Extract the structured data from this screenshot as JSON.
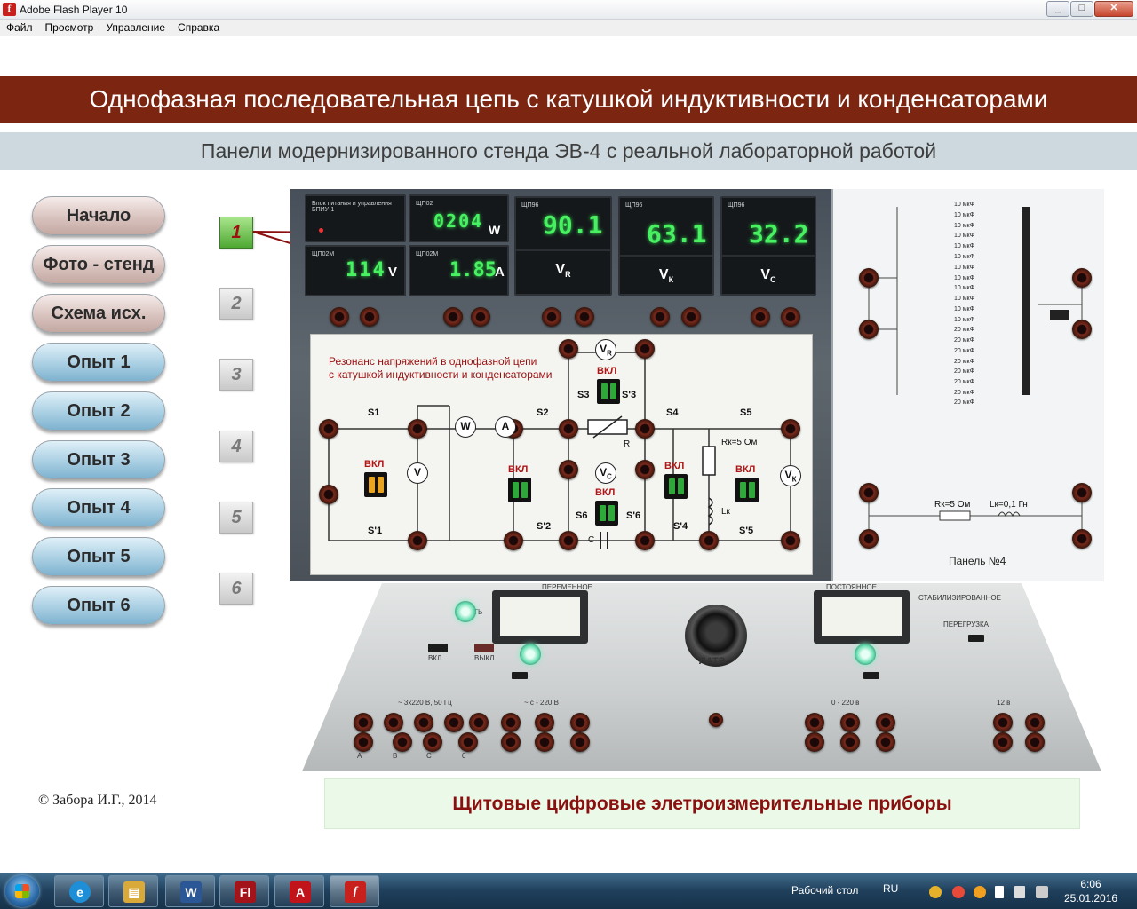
{
  "window": {
    "title": "Adobe Flash Player 10",
    "icon": "flash-icon",
    "controls": [
      "minimize-icon",
      "maximize-icon",
      "close-icon"
    ]
  },
  "menu": [
    "Файл",
    "Просмотр",
    "Управление",
    "Справка"
  ],
  "header": {
    "title": "Однофазная последовательная цепь с катушкой индуктивности и конденсаторами",
    "subtitle": "Панели модернизированного стенда ЭВ-4 с реальной лабораторной работой"
  },
  "nav": [
    {
      "label": "Начало",
      "style": "pink"
    },
    {
      "label": "Фото - стенд",
      "style": "pink"
    },
    {
      "label": "Схема исх.",
      "style": "pink"
    },
    {
      "label": "Опыт 1",
      "style": "blue"
    },
    {
      "label": "Опыт 2",
      "style": "blue"
    },
    {
      "label": "Опыт 3",
      "style": "blue"
    },
    {
      "label": "Опыт 4",
      "style": "blue"
    },
    {
      "label": "Опыт 5",
      "style": "blue"
    },
    {
      "label": "Опыт 6",
      "style": "blue"
    }
  ],
  "steps": [
    "1",
    "2",
    "3",
    "4",
    "5",
    "6"
  ],
  "active_step": "1",
  "stand": {
    "meters": {
      "power_block": {
        "brand": "Блок питания и управления БПИУ-1"
      },
      "wattmeter": {
        "brand": "ЩП02",
        "value": "0204",
        "unit": "W"
      },
      "voltmeter": {
        "brand": "ЩП02М",
        "value": "114",
        "unit": "V"
      },
      "ammeter": {
        "brand": "ЩП02М",
        "value": "1.85",
        "unit": "A"
      },
      "vr": {
        "brand": "ЩП96",
        "value": "90.1",
        "label": "V",
        "sub": "R"
      },
      "vk": {
        "brand": "ЩП96",
        "value": "63.1",
        "label": "V",
        "sub": "К"
      },
      "vc": {
        "brand": "ЩП96",
        "value": "32.2",
        "label": "V",
        "sub": "C"
      }
    },
    "schematic": {
      "caption_line1": "Резонанс  напряжений в однофазной цепи",
      "caption_line2": "с катушкой индуктивности и конденсаторами",
      "switch_labels": [
        "S1",
        "S2",
        "S3",
        "S'3",
        "S4",
        "S5",
        "S6",
        "S'1",
        "S'2",
        "S'4",
        "S'5",
        "S'6"
      ],
      "vkl": "ВКЛ",
      "instruments": {
        "w": "W",
        "a": "A",
        "v": "V",
        "vr": "V",
        "vr_sub": "R",
        "vc": "V",
        "vc_sub": "C",
        "vk": "V",
        "vk_sub": "К"
      },
      "r_label": "R",
      "rk_label": "Rк=5 Ом",
      "lk_label": "Lк",
      "c_label": "С"
    },
    "panel4": {
      "capacitors": [
        "10 мкФ",
        "10 мкФ",
        "10 мкФ",
        "10 мкФ",
        "10 мкФ",
        "10 мкФ",
        "10 мкФ",
        "10 мкФ",
        "10 мкФ",
        "10 мкФ",
        "10 мкФ",
        "10 мкФ",
        "20 мкФ",
        "20 мкФ",
        "20 мкФ",
        "20 мкФ",
        "20 мкФ",
        "20 мкФ",
        "20 мкФ",
        "20 мкФ"
      ],
      "rk": "Rк=5 Ом",
      "lk": "Lк=0,1 Гн",
      "name": "Панель №4"
    }
  },
  "console": {
    "set": "СЕТЬ",
    "alternating": "ПЕРЕМЕННОЕ",
    "direct": "ПОСТОЯННОЕ",
    "stabilized": "СТАБИЛИЗИРОВАННОЕ",
    "overload": "ПЕРЕГРУЗКА",
    "on": "ВКЛ",
    "off": "ВЫКЛ",
    "latr": "ЛАТР",
    "three_phase": "~ 3х220 В, 50 Гц",
    "single_phase": "~ с - 220 В",
    "dc": "0 - 220 в",
    "v12": "12 в",
    "phases": [
      "А",
      "В",
      "С",
      "0"
    ]
  },
  "footer": {
    "copyright": "© Забора И.Г., 2014",
    "caption": "Щитовые цифровые элетроизмерительные приборы"
  },
  "taskbar": {
    "apps": [
      {
        "name": "ie-icon",
        "glyph": "e",
        "color": "#1e8fd6"
      },
      {
        "name": "explorer-icon",
        "glyph": "▤",
        "color": "#d9a93a"
      },
      {
        "name": "word-icon",
        "glyph": "W",
        "color": "#2b5797"
      },
      {
        "name": "flash-pro-icon",
        "glyph": "Fl",
        "color": "#a3131a"
      },
      {
        "name": "acrobat-icon",
        "glyph": "A",
        "color": "#c0141a"
      },
      {
        "name": "flash-player-icon",
        "glyph": "f",
        "color": "#c8201c"
      }
    ],
    "desktop_label": "Рабочий стол",
    "lang": "RU",
    "time": "6:06",
    "date": "25.01.2016"
  }
}
